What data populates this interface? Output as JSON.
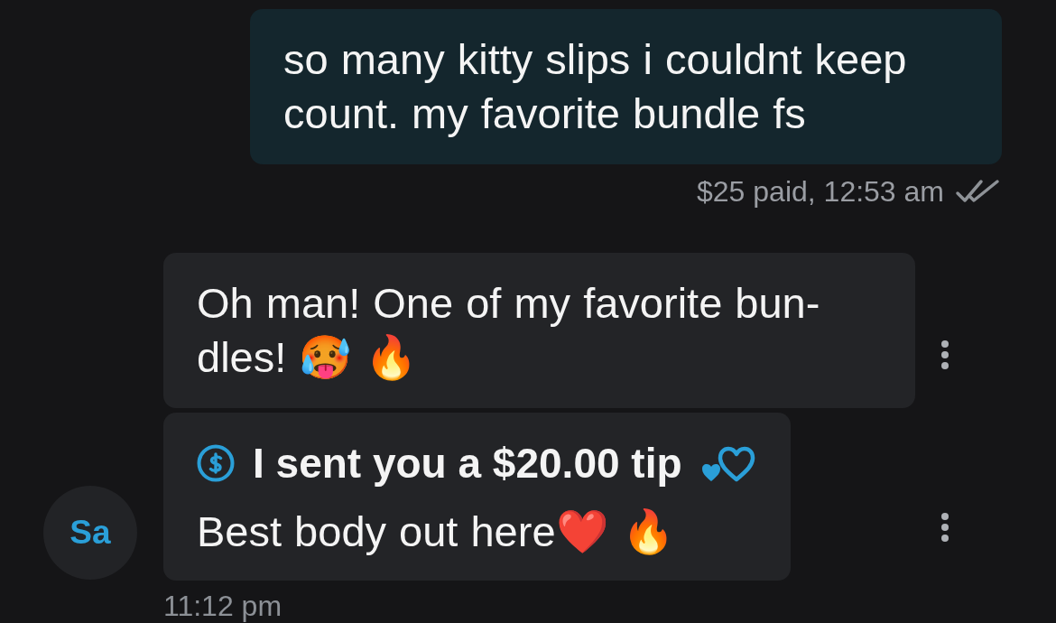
{
  "sent_messages": [
    {
      "kind": "sent",
      "text": "so many kitty slips i couldnt keep count. my favorite bundle fs",
      "status": "$25 paid, 12:53 am",
      "read": true
    }
  ],
  "incoming_group": {
    "avatar": {
      "initials": "Sa"
    },
    "messages": [
      {
        "kind": "text",
        "text": "Oh man! One of my favorite bun-dles! 🥵 🔥"
      },
      {
        "kind": "tip",
        "tip_text": "I sent you a $20.00 tip",
        "text": "Best body out here❤️ 🔥"
      }
    ],
    "time": "11:12 pm"
  }
}
